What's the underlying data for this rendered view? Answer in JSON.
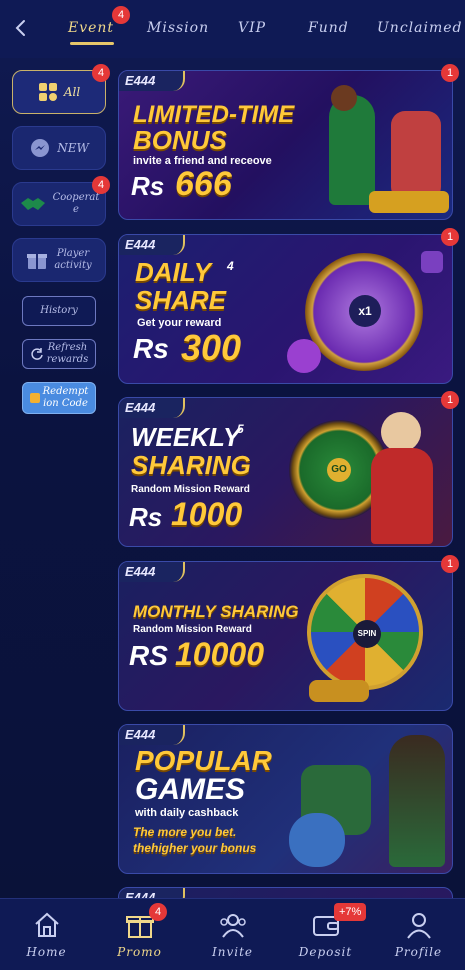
{
  "header": {
    "tabs": [
      {
        "label": "Event",
        "active": true,
        "badge": "4"
      },
      {
        "label": "Mission"
      },
      {
        "label": "VIP"
      },
      {
        "label": "Fund"
      },
      {
        "label": "Unclaimed"
      }
    ]
  },
  "sidebar": {
    "items": [
      {
        "label": "All",
        "badge": "4",
        "icon": "grid-icon"
      },
      {
        "label": "NEW",
        "icon": "messenger-icon"
      },
      {
        "label": "Cooperat\ne",
        "badge": "4",
        "icon": "handshake-icon"
      },
      {
        "label": "Player\nactivity",
        "icon": "gift-icon"
      }
    ],
    "history_label": "History",
    "refresh_label": "Refresh\nrewards",
    "redemption_label": "Redempt\nion Code"
  },
  "banners": [
    {
      "brand": "E444",
      "line1": "LIMITED-TIME",
      "line2": "BONUS",
      "subtitle": "invite a friend and receove",
      "currency": "Rs",
      "amount": "666",
      "badge": "1"
    },
    {
      "brand": "E444",
      "line1": "DAILY",
      "superscript": "4",
      "line2": "SHARE",
      "subtitle": "Get your reward",
      "currency": "Rs",
      "amount": "300",
      "wheel_center": "x1",
      "badge": "1"
    },
    {
      "brand": "E444",
      "line1": "WEEKLY",
      "superscript": "5",
      "line2": "SHARING",
      "subtitle": "Random Mission Reward",
      "currency": "Rs",
      "amount": "1000",
      "wheel_center": "GO",
      "badge": "1"
    },
    {
      "brand": "E444",
      "line1": "MONTHLY SHARING",
      "subtitle": "Random Mission Reward",
      "currency": "RS",
      "amount": "10000",
      "wheel_center": "SPIN",
      "badge": "1"
    },
    {
      "brand": "E444",
      "line1": "POPULAR",
      "line2": "GAMES",
      "subtitle": "with daily cashback",
      "tag1": "The more you bet.",
      "tag2": "thehigher your bonus"
    },
    {
      "brand": "E444"
    }
  ],
  "bottom_nav": [
    {
      "label": "Home",
      "icon": "home-icon"
    },
    {
      "label": "Promo",
      "icon": "gift-box-icon",
      "badge": "4",
      "active": true
    },
    {
      "label": "Invite",
      "icon": "people-icon"
    },
    {
      "label": "Deposit",
      "icon": "wallet-icon",
      "badge": "+7%"
    },
    {
      "label": "Profile",
      "icon": "user-icon"
    }
  ],
  "colors": {
    "background": "#0b1340",
    "accent_gold": "#f0d88a",
    "badge_red": "#e53838"
  }
}
